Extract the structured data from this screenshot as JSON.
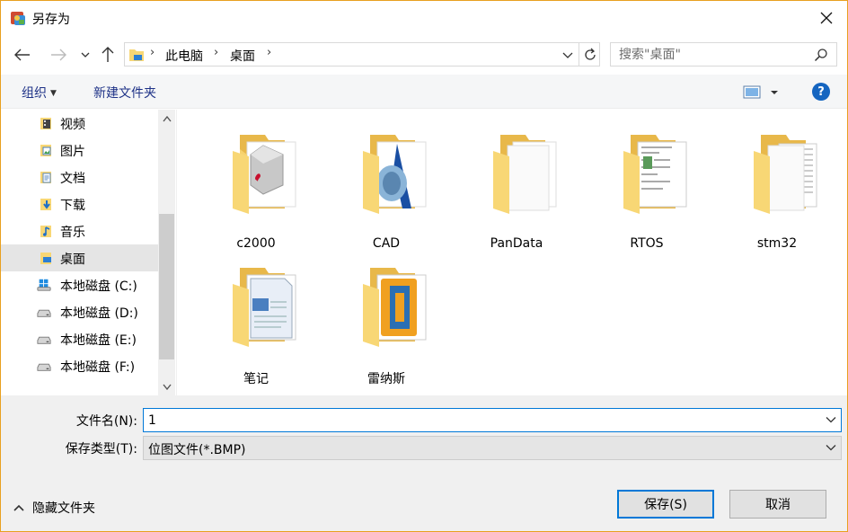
{
  "window": {
    "title": "另存为"
  },
  "address": {
    "crumbs": [
      "此电脑",
      "桌面"
    ]
  },
  "search": {
    "placeholder": "搜索\"桌面\""
  },
  "toolbar": {
    "organize_label": "组织",
    "new_folder_label": "新建文件夹",
    "help_label": "?"
  },
  "sidebar": {
    "items": [
      {
        "label": "视频",
        "icon": "video-folder-icon"
      },
      {
        "label": "图片",
        "icon": "pictures-folder-icon"
      },
      {
        "label": "文档",
        "icon": "documents-folder-icon"
      },
      {
        "label": "下载",
        "icon": "downloads-folder-icon"
      },
      {
        "label": "音乐",
        "icon": "music-folder-icon"
      },
      {
        "label": "桌面",
        "icon": "desktop-folder-icon",
        "selected": true
      },
      {
        "label": "本地磁盘 (C:)",
        "icon": "windows-drive-icon"
      },
      {
        "label": "本地磁盘 (D:)",
        "icon": "drive-icon"
      },
      {
        "label": "本地磁盘 (E:)",
        "icon": "drive-icon"
      },
      {
        "label": "本地磁盘 (F:)",
        "icon": "drive-icon"
      }
    ]
  },
  "files": [
    {
      "name": "c2000",
      "icon": "folder-icon"
    },
    {
      "name": "CAD",
      "icon": "folder-icon"
    },
    {
      "name": "PanData",
      "icon": "folder-icon"
    },
    {
      "name": "RTOS",
      "icon": "folder-icon"
    },
    {
      "name": "stm32",
      "icon": "folder-icon"
    },
    {
      "name": "笔记",
      "icon": "folder-icon"
    },
    {
      "name": "雷纳斯",
      "icon": "folder-icon"
    }
  ],
  "form": {
    "filename_label": "文件名(N):",
    "filename_value": "1",
    "filetype_label": "保存类型(T):",
    "filetype_value": "位图文件(*.BMP)"
  },
  "footer": {
    "hide_folders_label": "隐藏文件夹",
    "save_label": "保存(S)",
    "cancel_label": "取消"
  },
  "colors": {
    "accent": "#0078d7",
    "folder": "#f8d775",
    "window_border": "#e8a020"
  }
}
